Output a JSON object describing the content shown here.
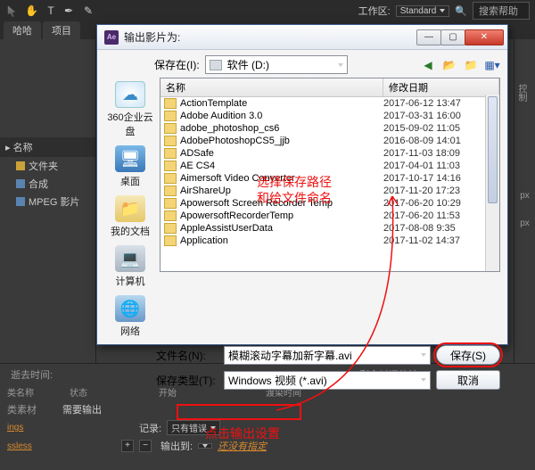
{
  "topbar": {
    "workspace_label": "工作区:",
    "workspace_value": "Standard",
    "search_placeholder": "搜索帮助"
  },
  "tabs": {
    "t1": "哈哈",
    "t2": "项目"
  },
  "project": {
    "header": "名称",
    "items": [
      {
        "label": "文件夹"
      },
      {
        "label": "合成"
      },
      {
        "label": "MPEG 影片"
      }
    ]
  },
  "right_panel": {
    "label1": "控制",
    "px": "px"
  },
  "dialog": {
    "title": "输出影片为:",
    "save_in_label": "保存在(I):",
    "drive_label": "软件 (D:)",
    "places": {
      "cloud": "360企业云盘",
      "desktop": "桌面",
      "mydocs": "我的文档",
      "computer": "计算机",
      "network": "网络"
    },
    "columns": {
      "name": "名称",
      "date": "修改日期"
    },
    "files": [
      {
        "name": "ActionTemplate",
        "date": "2017-06-12 13:47"
      },
      {
        "name": "Adobe Audition 3.0",
        "date": "2017-03-31 16:00"
      },
      {
        "name": "adobe_photoshop_cs6",
        "date": "2015-09-02 11:05"
      },
      {
        "name": "AdobePhotoshopCS5_jjb",
        "date": "2016-08-09 14:01"
      },
      {
        "name": "ADSafe",
        "date": "2017-11-03 18:09"
      },
      {
        "name": "AE CS4",
        "date": "2017-04-01 11:03"
      },
      {
        "name": "Aimersoft Video Converter",
        "date": "2017-10-17 14:16"
      },
      {
        "name": "AirShareUp",
        "date": "2017-11-20 17:23"
      },
      {
        "name": "Apowersoft Screen Recorder Temp",
        "date": "2017-06-20 10:29"
      },
      {
        "name": "ApowersoftRecorderTemp",
        "date": "2017-06-20 11:53"
      },
      {
        "name": "AppleAssistUserData",
        "date": "2017-08-08 9:35"
      },
      {
        "name": "Application",
        "date": "2017-11-02 14:37"
      }
    ],
    "filename_label": "文件名(N):",
    "filename_value": "模糊滚动字幕加新字幕.avi",
    "filetype_label": "保存类型(T):",
    "filetype_value": "Windows 视频 (*.avi)",
    "save_btn": "保存(S)",
    "cancel_btn": "取消"
  },
  "bottom": {
    "col_name": "类名称",
    "col_status": "状态",
    "col_start": "开始",
    "time_elapsed_label": "逝去时间:",
    "time_remaining_label": "剩余时间估计:",
    "render_time_label": "渡染时间",
    "row_source": "类素材",
    "row_status_val": "需要输出",
    "record_label": "记录:",
    "record_value": "只有错误",
    "output_to_label": "输出到:",
    "output_to_value": "还没有指定",
    "link1": "ings",
    "link2": "ssless"
  },
  "annotations": {
    "anno1a": "选择保存路径",
    "anno1b": "和给文件命名",
    "anno2": "点击输出设置"
  }
}
